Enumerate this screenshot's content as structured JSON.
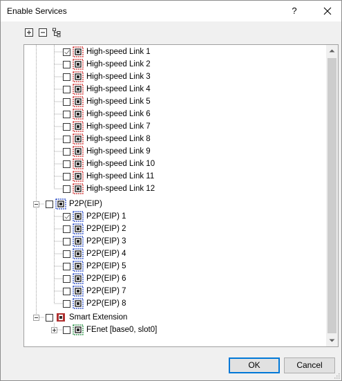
{
  "window": {
    "title": "Enable Services",
    "help_label": "?",
    "close_icon": "close-icon"
  },
  "toolbar": {
    "buttons": [
      "expand-all-icon",
      "collapse-all-icon",
      "tree-structure-icon"
    ]
  },
  "tree": {
    "hs_links": [
      {
        "label": "High-speed Link 1",
        "checked": true
      },
      {
        "label": "High-speed Link 2",
        "checked": false
      },
      {
        "label": "High-speed Link 3",
        "checked": false
      },
      {
        "label": "High-speed Link 4",
        "checked": false
      },
      {
        "label": "High-speed Link 5",
        "checked": false
      },
      {
        "label": "High-speed Link 6",
        "checked": false
      },
      {
        "label": "High-speed Link 7",
        "checked": false
      },
      {
        "label": "High-speed Link 8",
        "checked": false
      },
      {
        "label": "High-speed Link 9",
        "checked": false
      },
      {
        "label": "High-speed Link 10",
        "checked": false
      },
      {
        "label": "High-speed Link 11",
        "checked": false
      },
      {
        "label": "High-speed Link 12",
        "checked": false
      }
    ],
    "p2p_group": {
      "label": "P2P(EIP)",
      "checked": false,
      "expanded": true
    },
    "p2p_items": [
      {
        "label": "P2P(EIP) 1",
        "checked": true
      },
      {
        "label": "P2P(EIP) 2",
        "checked": false
      },
      {
        "label": "P2P(EIP) 3",
        "checked": false
      },
      {
        "label": "P2P(EIP) 4",
        "checked": false
      },
      {
        "label": "P2P(EIP) 5",
        "checked": false
      },
      {
        "label": "P2P(EIP) 6",
        "checked": false
      },
      {
        "label": "P2P(EIP) 7",
        "checked": false
      },
      {
        "label": "P2P(EIP) 8",
        "checked": false
      }
    ],
    "smart_group": {
      "label": "Smart Extension",
      "checked": false,
      "expanded": true
    },
    "smart_items": [
      {
        "label": "FEnet [base0, slot0]",
        "checked": false,
        "expanded": false
      }
    ]
  },
  "buttons": {
    "ok": "OK",
    "cancel": "Cancel"
  },
  "colors": {
    "hs_icon": "#cc2222",
    "p2p_icon": "#1a3fc0",
    "smart_icon": "#b03030",
    "fenet_icon": "#1a8a3a",
    "ok_border": "#0078d7"
  }
}
